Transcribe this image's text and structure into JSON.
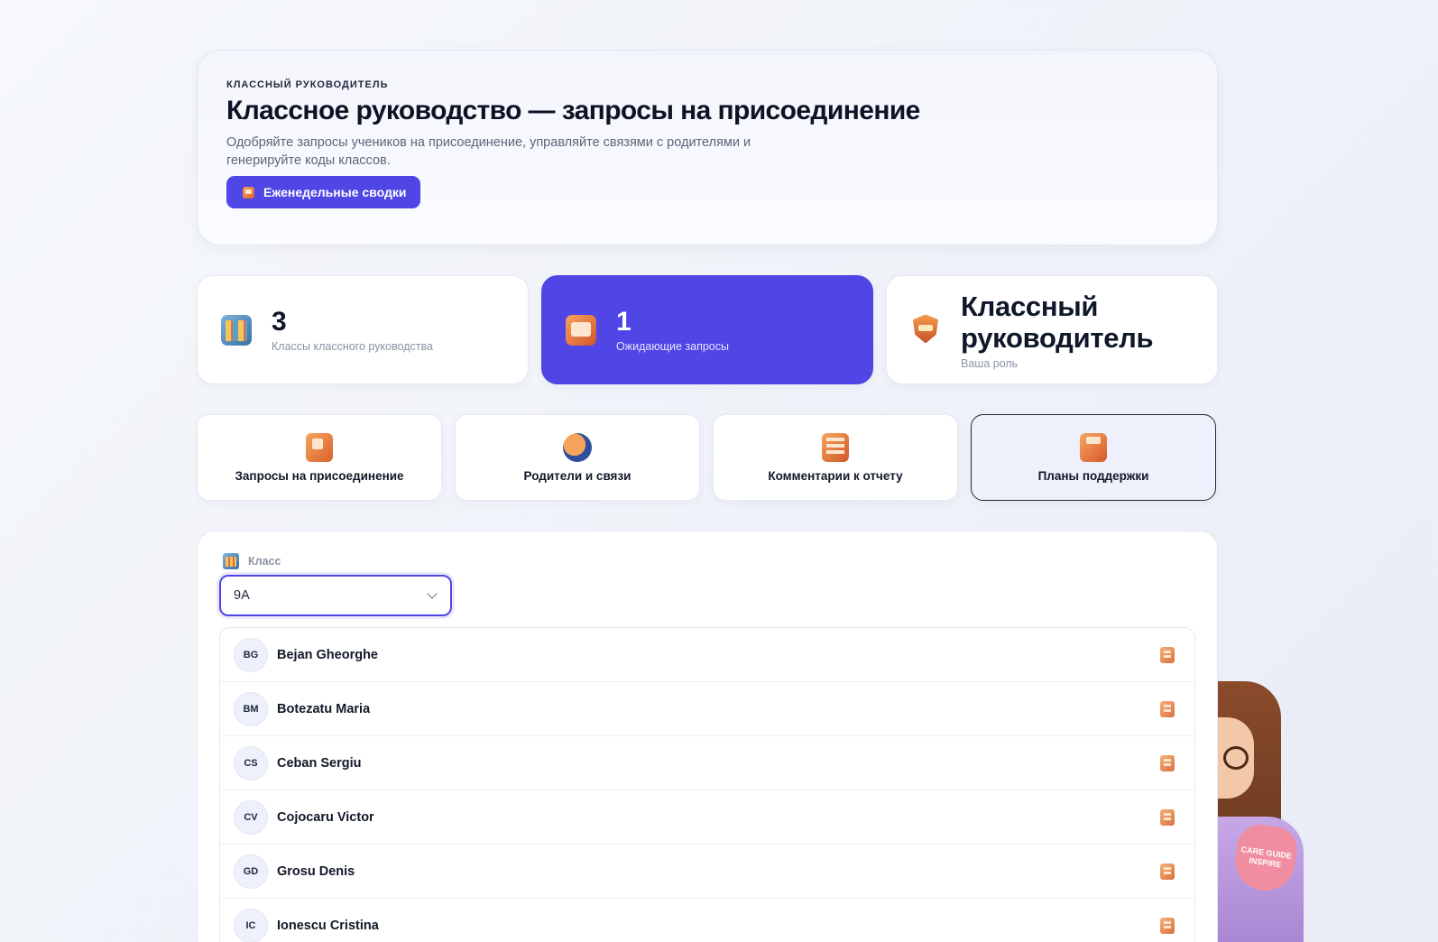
{
  "hero": {
    "eyebrow": "КЛАССНЫЙ РУКОВОДИТЕЛЬ",
    "title": "Классное руководство — запросы на присоединение",
    "description": "Одобряйте запросы учеников на присоединение, управляйте связями с родителями и генерируйте коды классов.",
    "button_label": "Еженедельные сводки"
  },
  "stats": [
    {
      "value": "3",
      "label": "Классы классного руководства",
      "icon": "classroom-grid-icon"
    },
    {
      "value": "1",
      "label": "Ожидающие запросы",
      "icon": "mailbox-icon"
    },
    {
      "value": "Классный руководитель",
      "label": "Ваша роль",
      "icon": "shield-badge-icon"
    }
  ],
  "tabs": [
    {
      "label": "Запросы на присоединение",
      "icon": "join-request-icon"
    },
    {
      "label": "Родители и связи",
      "icon": "parents-icon"
    },
    {
      "label": "Комментарии к отчету",
      "icon": "report-comment-icon"
    },
    {
      "label": "Планы поддержки",
      "icon": "support-plan-icon"
    }
  ],
  "filter": {
    "label": "Класс",
    "selected": "9A"
  },
  "students": [
    {
      "initials": "BG",
      "name": "Bejan Gheorghe"
    },
    {
      "initials": "BM",
      "name": "Botezatu Maria"
    },
    {
      "initials": "CS",
      "name": "Ceban Sergiu"
    },
    {
      "initials": "CV",
      "name": "Cojocaru Victor"
    },
    {
      "initials": "GD",
      "name": "Grosu Denis"
    },
    {
      "initials": "IC",
      "name": "Ionescu Cristina"
    }
  ],
  "mascot": {
    "sign_text": "CARE GUIDE INSPIRE"
  },
  "colors": {
    "accent": "#4f46e5",
    "icon_orange": "#f6a35c"
  }
}
